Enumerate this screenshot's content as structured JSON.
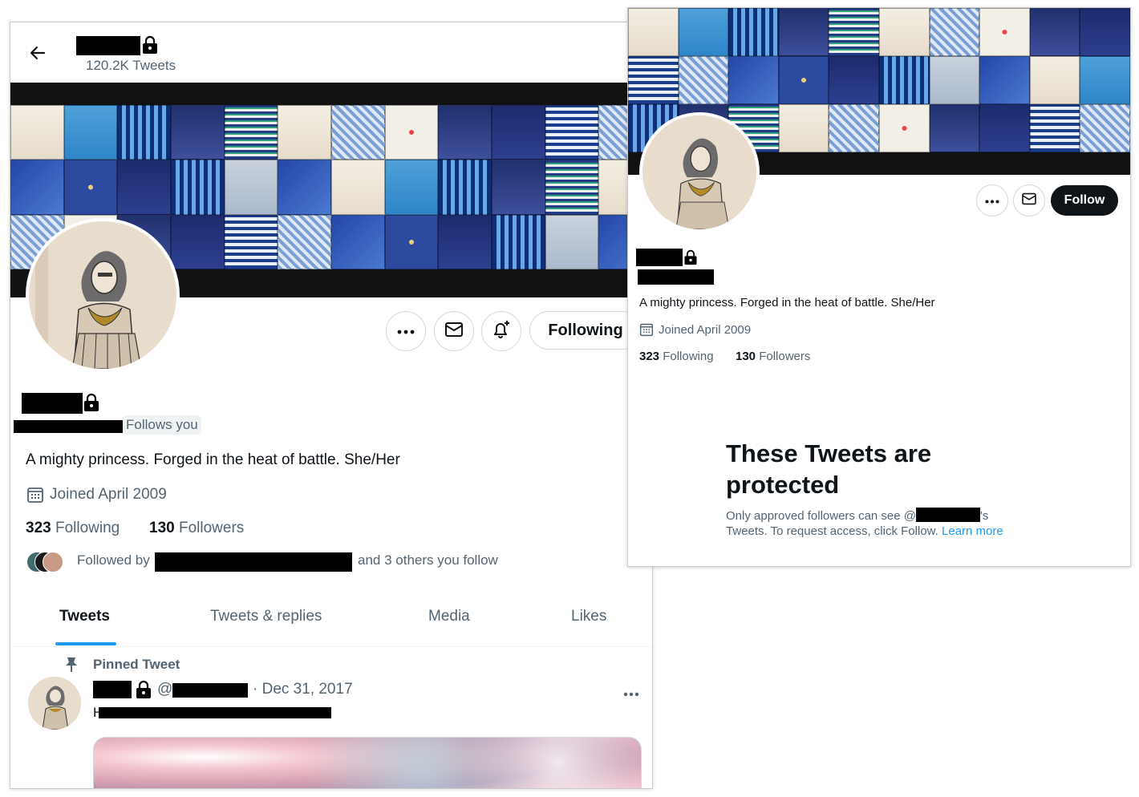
{
  "left": {
    "header": {
      "tweet_count": "120.2K Tweets"
    },
    "badge": "Follows you",
    "bio": "A mighty princess. Forged in the heat of battle. She/Her",
    "joined": "Joined April 2009",
    "following_count": "323",
    "following_label": "Following",
    "followers_count": "130",
    "followers_label": "Followers",
    "followed_by_prefix": "Followed by",
    "followed_by_suffix": "and 3 others you follow",
    "following_button": "Following",
    "tabs": [
      "Tweets",
      "Tweets & replies",
      "Media",
      "Likes"
    ],
    "active_tab": "Tweets",
    "pinned_label": "Pinned Tweet",
    "tweet_at": "@",
    "tweet_date": "· Dec 31, 2017",
    "tweet_text_prefix": "H"
  },
  "right": {
    "follow_button": "Follow",
    "bio": "A mighty princess. Forged in the heat of battle. She/Her",
    "joined": "Joined April 2009",
    "following_count": "323",
    "following_label": "Following",
    "followers_count": "130",
    "followers_label": "Followers",
    "protected_title": "These Tweets are protected",
    "protected_line1_prefix": "Only approved followers can see @",
    "protected_line1_suffix": "'s",
    "protected_line2": "Tweets. To request access, click Follow.",
    "learn_more": "Learn more"
  },
  "colors": {
    "accent": "#1d9bf0",
    "text": "#0f1419",
    "muted": "#536471",
    "border": "#cfd9de"
  },
  "icons": [
    "back-arrow-icon",
    "lock-icon",
    "more-icon",
    "mail-icon",
    "bell-plus-icon",
    "calendar-icon",
    "pin-icon"
  ]
}
